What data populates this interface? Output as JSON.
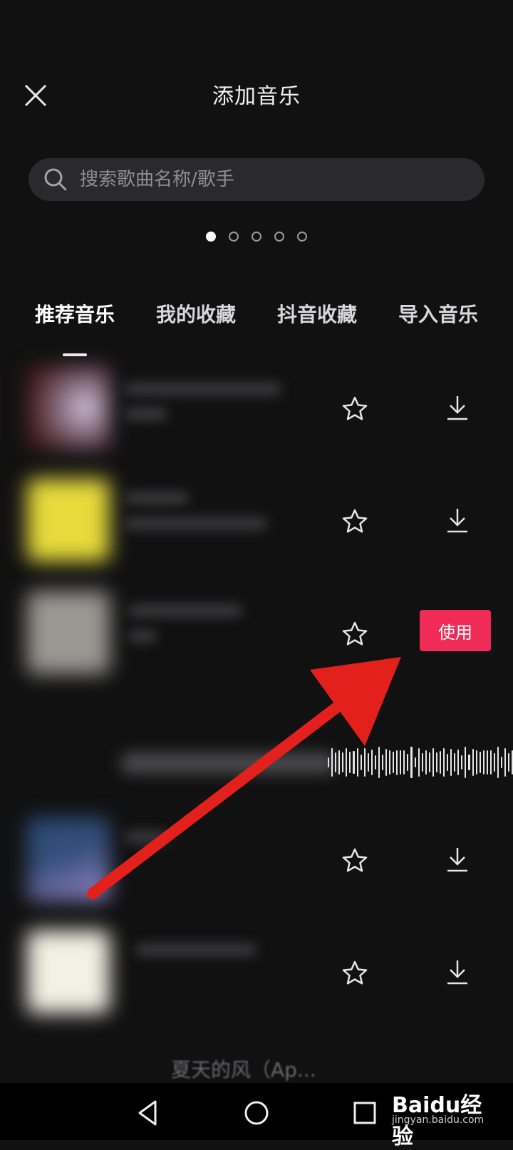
{
  "header": {
    "title": "添加音乐",
    "close_icon": "close-icon"
  },
  "search": {
    "placeholder": "搜索歌曲名称/歌手"
  },
  "pager": {
    "count": 5,
    "active": 0
  },
  "tabs": [
    {
      "label": "推荐音乐",
      "active": true
    },
    {
      "label": "我的收藏",
      "active": false
    },
    {
      "label": "抖音收藏",
      "active": false
    },
    {
      "label": "导入音乐",
      "active": false
    }
  ],
  "rows": [
    {
      "state": "default"
    },
    {
      "state": "default"
    },
    {
      "state": "selected",
      "use_label": "使用"
    },
    {
      "state": "playing"
    },
    {
      "state": "default"
    },
    {
      "state": "default"
    }
  ],
  "partial_row_title": "夏天的风（Ap...",
  "colors": {
    "accent": "#f02b57",
    "background": "#111112",
    "annotation_arrow": "#e3201b"
  },
  "watermark": {
    "brand": "Baidu经验",
    "sub": "jingyan.baidu.com"
  }
}
